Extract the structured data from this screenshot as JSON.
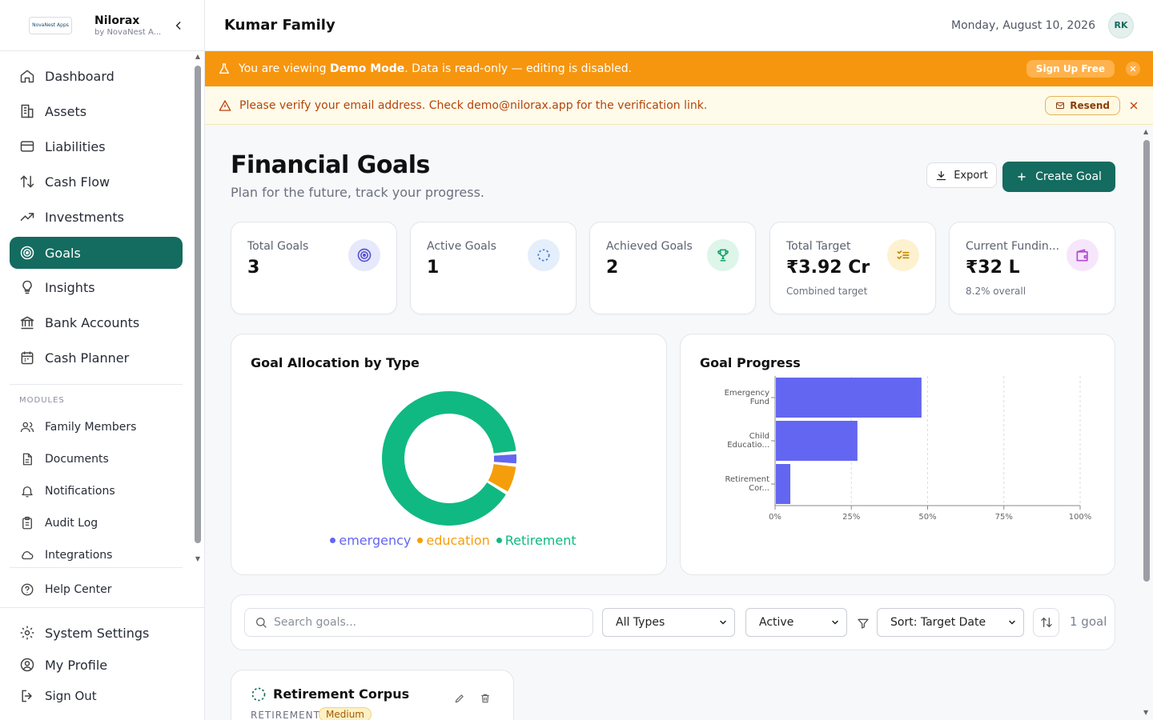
{
  "brand": {
    "logo_text": "NovaNest Apps",
    "name": "Nilorax",
    "sub": "by NovaNest A..."
  },
  "nav": {
    "items": [
      {
        "label": "Dashboard",
        "icon": "home-icon"
      },
      {
        "label": "Assets",
        "icon": "building-icon"
      },
      {
        "label": "Liabilities",
        "icon": "credit-card-icon"
      },
      {
        "label": "Cash Flow",
        "icon": "arrows-updown-icon"
      },
      {
        "label": "Investments",
        "icon": "trending-up-icon"
      },
      {
        "label": "Goals",
        "icon": "target-icon",
        "active": true
      },
      {
        "label": "Insights",
        "icon": "lightbulb-icon"
      },
      {
        "label": "Bank Accounts",
        "icon": "bank-icon"
      },
      {
        "label": "Cash Planner",
        "icon": "calendar-icon"
      }
    ],
    "modules_label": "MODULES",
    "modules": [
      {
        "label": "Family Members",
        "icon": "users-icon"
      },
      {
        "label": "Documents",
        "icon": "document-icon"
      },
      {
        "label": "Notifications",
        "icon": "bell-icon"
      },
      {
        "label": "Audit Log",
        "icon": "clipboard-icon"
      },
      {
        "label": "Integrations",
        "icon": "cloud-icon"
      }
    ],
    "help": "Help Center",
    "bottom": [
      {
        "label": "System Settings",
        "icon": "gear-icon"
      },
      {
        "label": "My Profile",
        "icon": "user-circle-icon"
      },
      {
        "label": "Sign Out",
        "icon": "logout-icon"
      }
    ]
  },
  "header": {
    "title": "Kumar Family",
    "date": "Monday, August 10, 2026",
    "avatar": "RK"
  },
  "demo_banner": {
    "prefix": "You are viewing ",
    "bold": "Demo Mode",
    "suffix": ". Data is read-only — editing is disabled.",
    "cta": "Sign Up Free"
  },
  "verify_banner": {
    "text": "Please verify your email address. Check demo@nilorax.app for the verification link.",
    "cta": "Resend"
  },
  "page": {
    "title": "Financial Goals",
    "subtitle": "Plan for the future, track your progress.",
    "export_label": "Export",
    "create_label": "Create Goal"
  },
  "stats": [
    {
      "label": "Total Goals",
      "value": "3",
      "sub": "",
      "icon": "target-icon",
      "bg": "#e6e8fb",
      "fg": "#5b52d6"
    },
    {
      "label": "Active Goals",
      "value": "1",
      "sub": "",
      "icon": "loading-circle-icon",
      "bg": "#e5eefb",
      "fg": "#3b7be0"
    },
    {
      "label": "Achieved Goals",
      "value": "2",
      "sub": "",
      "icon": "trophy-icon",
      "bg": "#def5ea",
      "fg": "#12a36a"
    },
    {
      "label": "Total Target",
      "value": "₹3.92 Cr",
      "sub": "Combined target",
      "icon": "checklist-icon",
      "bg": "#fdf1cf",
      "fg": "#c48a00"
    },
    {
      "label": "Current Fundin...",
      "value": "₹32 L",
      "sub": "8.2% overall",
      "icon": "wallet-icon",
      "bg": "#f6e6fb",
      "fg": "#b14ad0"
    }
  ],
  "allocation_chart": {
    "title": "Goal Allocation by Type",
    "legend": [
      {
        "name": "emergency",
        "color": "#6366f1"
      },
      {
        "name": "education",
        "color": "#f59e0b"
      },
      {
        "name": "Retirement",
        "color": "#10b981"
      }
    ]
  },
  "progress_chart_title": "Goal Progress",
  "chart_data": [
    {
      "type": "pie",
      "title": "Goal Allocation by Type",
      "categories": [
        "emergency",
        "education",
        "Retirement"
      ],
      "values": [
        3,
        7,
        90
      ],
      "colors": [
        "#6366f1",
        "#f59e0b",
        "#10b981"
      ],
      "legend": "bottom"
    },
    {
      "type": "bar",
      "orientation": "horizontal",
      "title": "Goal Progress",
      "categories": [
        [
          "Emergency",
          "Fund"
        ],
        [
          "Child",
          "Educatio..."
        ],
        [
          "Retirement",
          "Cor..."
        ]
      ],
      "values": [
        48,
        27,
        5
      ],
      "xlim": [
        0,
        100
      ],
      "xticks": [
        "0%",
        "25%",
        "50%",
        "75%",
        "100%"
      ],
      "color": "#6366f1",
      "grid": "vertical dashed"
    }
  ],
  "filters": {
    "search_placeholder": "Search goals...",
    "type": "All Types",
    "status": "Active",
    "sort": "Sort: Target Date",
    "count": "1 goal"
  },
  "goal": {
    "name": "Retirement Corpus",
    "type": "RETIREMENT",
    "priority": "Medium"
  }
}
